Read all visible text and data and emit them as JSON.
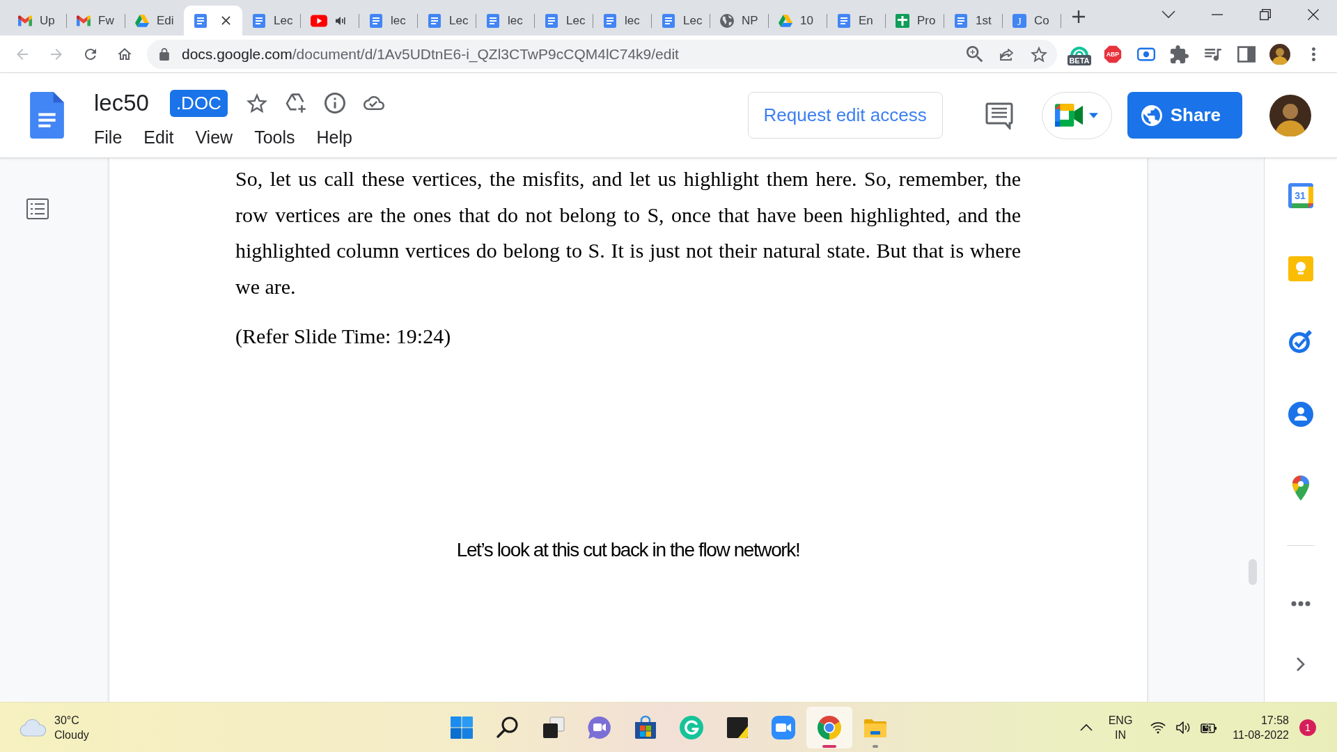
{
  "browser": {
    "tabs": [
      {
        "kind": "mail",
        "label": "Up",
        "selected": false,
        "audible": false
      },
      {
        "kind": "mail",
        "label": "Fw",
        "selected": false,
        "audible": false
      },
      {
        "kind": "drive",
        "label": "Edi",
        "selected": false,
        "audible": false
      },
      {
        "kind": "doc",
        "selected": true,
        "audible": false
      },
      {
        "kind": "doc",
        "label": "Lec",
        "selected": false,
        "audible": false
      },
      {
        "kind": "video",
        "selected": false,
        "audible": true
      },
      {
        "kind": "doc",
        "label": "lec",
        "selected": false,
        "audible": false
      },
      {
        "kind": "doc",
        "label": "Lec",
        "selected": false,
        "audible": false
      },
      {
        "kind": "doc",
        "label": "lec",
        "selected": false,
        "audible": false
      },
      {
        "kind": "doc",
        "label": "Lec",
        "selected": false,
        "audible": false
      },
      {
        "kind": "doc",
        "label": "lec",
        "selected": false,
        "audible": false
      },
      {
        "kind": "doc",
        "label": "Lec",
        "selected": false,
        "audible": false
      },
      {
        "kind": "globe",
        "label": "NP",
        "selected": false,
        "audible": false
      },
      {
        "kind": "drive",
        "label": "10",
        "selected": false,
        "audible": false
      },
      {
        "kind": "doc",
        "label": "En",
        "selected": false,
        "audible": false
      },
      {
        "kind": "sheet",
        "label": "Pro",
        "selected": false,
        "audible": false
      },
      {
        "kind": "doc",
        "label": "1st",
        "selected": false,
        "audible": false
      },
      {
        "kind": "letter",
        "glyph": "J",
        "label": "Co",
        "selected": false,
        "audible": false
      }
    ],
    "navigation": {
      "back_disabled": true,
      "forward_disabled": true
    },
    "address": {
      "host": "docs.google.com",
      "path": "/document/d/1Av5UDtnE6-i_QZl3CTwP9cCQM4lC74k9/edit"
    },
    "extensions": [
      {
        "kind": "arc",
        "badge": "BETA"
      },
      {
        "kind": "octagon",
        "badge": "ABP"
      },
      {
        "kind": "record"
      },
      {
        "kind": "puzzle"
      },
      {
        "kind": "playlist"
      },
      {
        "kind": "panel"
      }
    ]
  },
  "docs": {
    "title": "lec50",
    "file_type": ".DOC",
    "menu": [
      "File",
      "Edit",
      "View",
      "Tools",
      "Help"
    ],
    "request_access": "Request edit access",
    "share": "Share"
  },
  "document": {
    "paragraph": "So, let us call these vertices, the misfits, and let us highlight them here. So, remember, the row vertices are the ones that do not belong to S, once that have been highlighted, and the highlighted column vertices do belong to S. It is just not their natural state. But that is where we are.",
    "caption": "(Refer Slide Time: 19:24)",
    "slide_text": "Let’s look at this cut back in the flow network!"
  },
  "side_panel": {
    "calendar_day": "31"
  },
  "taskbar": {
    "weather": {
      "temperature": "30°C",
      "condition": "Cloudy"
    },
    "apps": [
      {
        "kind": "start",
        "selected": false,
        "running": false
      },
      {
        "kind": "search",
        "selected": false,
        "running": false
      },
      {
        "kind": "taskview",
        "selected": false,
        "running": false
      },
      {
        "kind": "chat",
        "selected": false,
        "running": false
      },
      {
        "kind": "store",
        "selected": false,
        "running": false
      },
      {
        "kind": "grammar",
        "selected": false,
        "running": false
      },
      {
        "kind": "notes",
        "selected": false,
        "running": false
      },
      {
        "kind": "meeting",
        "selected": false,
        "running": false
      },
      {
        "kind": "browser",
        "selected": true,
        "running": true
      },
      {
        "kind": "folder",
        "selected": false,
        "running": true
      }
    ],
    "language": "ENG",
    "region": "IN",
    "time": "17:58",
    "date": "11-08-2022",
    "notifications": "1"
  }
}
